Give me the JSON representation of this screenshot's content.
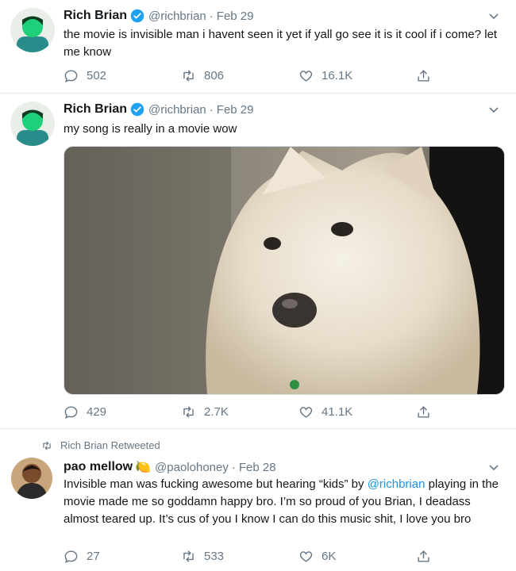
{
  "tweets": [
    {
      "name": "Rich Brian",
      "handle": "@richbrian",
      "separator": "·",
      "date": "Feb 29",
      "text": "the movie is invisible man i havent seen it yet if yall go see it is it cool if i come? let me know",
      "replies": "502",
      "retweets": "806",
      "likes": "16.1K"
    },
    {
      "name": "Rich Brian",
      "handle": "@richbrian",
      "separator": "·",
      "date": "Feb 29",
      "text": "my song is really in a movie wow",
      "replies": "429",
      "retweets": "2.7K",
      "likes": "41.1K"
    },
    {
      "retweeted_label": "Rich Brian Retweeted",
      "name": "pao mellow",
      "name_emoji": "🍋",
      "handle": "@paolohoney",
      "separator": "·",
      "date": "Feb 28",
      "text_before_mention": "Invisible man was fucking awesome  but hearing “kids” by ",
      "mention": "@richbrian",
      "text_after_mention": " playing in the movie made me so goddamn happy bro. I’m so proud of you Brian, I deadass almost teared up. It’s cus of you I know I can do this music shit, I love you bro",
      "replies": "27",
      "retweets": "533",
      "likes": "6K"
    }
  ],
  "icons": {
    "verified_color": "#1da1f2",
    "avatar_green": "#1fd07a",
    "action_color": "#657786"
  }
}
